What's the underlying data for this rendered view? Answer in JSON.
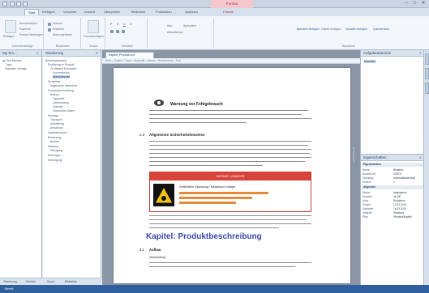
{
  "titlebar": {
    "title": "",
    "context_tab": "Format",
    "min": "–",
    "max": "□",
    "close": "✕"
  },
  "tabs": [
    "Start",
    "Einfügen",
    "Verweise",
    "Ansicht",
    "Überprüfen",
    "Bibliothek",
    "Publikation",
    "Optionen",
    "Format"
  ],
  "ribbon": {
    "groups": [
      {
        "label": "Zwischenablage",
        "items": [
          "Einfügen",
          "Ausschneiden",
          "Kopieren",
          "Format übertragen"
        ]
      },
      {
        "label": "Bearbeiten",
        "items": [
          "Suchen",
          "Ersetzen",
          "Alles markieren"
        ]
      },
      {
        "label": "Absatz",
        "items": [
          "Formatvorlagen"
        ]
      },
      {
        "label": "Schriftart",
        "items": [
          "F",
          "K",
          "U",
          "x²"
        ]
      },
      {
        "label": "",
        "items": [
          "Neu",
          "Speichern",
          "Aktualisieren"
        ]
      },
      {
        "label": "Bausteine",
        "items": [
          "Baustein einfügen",
          "Objekt einfügen",
          "Variable einfügen",
          "Querverweis"
        ]
      }
    ]
  },
  "left1": {
    "title": "My Sm...",
    "items": [
      "gp Test Struktur",
      "Topic",
      "Baustein Vorlage"
    ]
  },
  "left2": {
    "title": "Gliederung",
    "items": [
      "Betriebsanleitung",
      "Einführung in Produkt",
      "Zu diesem Dokument",
      "Konventionen",
      "Warnhinweise",
      "Sicherheit",
      "Allgemeine Sicherheit",
      "Produktbeschreibung",
      "Aufbau",
      "Typschild",
      "Lieferumfang",
      "Zubehör",
      "Technische Daten",
      "Montage",
      "Transport",
      "Aufstellung",
      "Anschluss",
      "Inbetriebnahme",
      "Bedienung",
      "Betrieb",
      "Wartung",
      "Reinigung",
      "Störungen",
      "Entsorgung"
    ]
  },
  "left_tabs": [
    "Gliederung",
    "Struktur",
    "Suche",
    "Bibliothek"
  ],
  "doc": {
    "tab": "Kapitel_Produkt.xml",
    "breadcrumb": "Buch > Kapitel > Topic > Abschnitt > Absatz > Warnhinweis > Text",
    "heading_warn": "Warnung vor Fehlgebrauch",
    "sec_num": "2.2",
    "sec_title": "Allgemeine Sicherheitshinweise",
    "warn_header": "GEFAHR / DANGER",
    "warn_text": "Gefährliche Spannung / Hazardous voltage",
    "chapter": "Kapitel: Produktbeschreibung",
    "sub_num": "3.1",
    "sub_title": "Aufbau",
    "usage": "Verwendung",
    "vertical": "Seitenansicht"
  },
  "right": {
    "tasks_title": "Aufgabenbereich",
    "tasks_item": "Übersicht",
    "props_title": "Eigenschaften",
    "props_cat1": "Eigenschaften",
    "props_cat2": "Allgemein",
    "props_rows": [
      [
        "Name",
        "Baustein"
      ],
      [
        "Baustein ID",
        "270071"
      ],
      [
        "Objekttyp",
        "Informationseinheit"
      ],
      [
        "Version",
        "1"
      ],
      [
        "Status",
        "freigegeben"
      ],
      [
        "Sprache",
        "de-DE"
      ],
      [
        "Autor",
        "Redakteur"
      ],
      [
        "Erstellt",
        "12.03.2013"
      ],
      [
        "Geändert",
        "14.03.2013"
      ],
      [
        "Variante",
        "Standard"
      ],
      [
        "Pfad",
        "/Produkt/Kapitel"
      ]
    ]
  },
  "status": {
    "text": "Bereit"
  }
}
